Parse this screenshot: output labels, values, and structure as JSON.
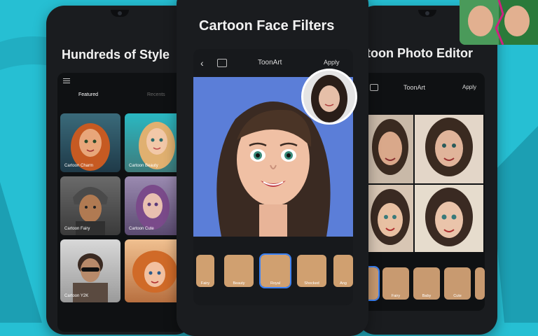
{
  "left_phone": {
    "title": "Hundreds of Style",
    "tabs": [
      "Featured",
      "Recents"
    ],
    "tiles": [
      "Cartoon Charm",
      "Cartoon Beauty",
      "Cartoon Fairy",
      "Cartoon Cute",
      "Cartoon Y2K",
      ""
    ]
  },
  "center_phone": {
    "title": "Cartoon Face Filters",
    "app_name": "ToonArt",
    "apply_label": "Apply",
    "filters": [
      "Fairy",
      "Beauty",
      "Royal",
      "Shocked",
      "Ang"
    ]
  },
  "right_phone": {
    "title": "rtoon Photo Editor",
    "app_name": "ToonArt",
    "apply_label": "Apply",
    "filters": [
      "",
      "Fairy",
      "Baby",
      "Cute",
      ""
    ]
  },
  "colors": {
    "background": "#26bfd3",
    "accent": "#3b82f6",
    "phone_body": "#1a1c1f"
  }
}
